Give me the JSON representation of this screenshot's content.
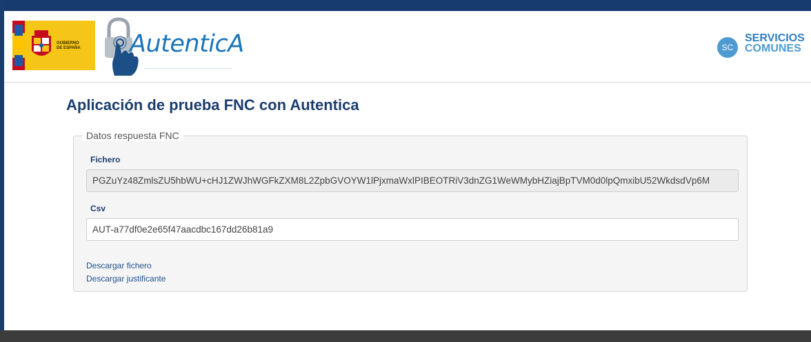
{
  "header": {
    "gobierno_text_line1": "GOBIERNO",
    "gobierno_text_line2": "DE ESPAÑA",
    "app_logo_text": "AutenticA",
    "servicios_line1": "SERVICIOS",
    "servicios_line2": "COMUNES",
    "servicios_badge": "SC"
  },
  "main": {
    "title": "Aplicación de prueba FNC con Autentica",
    "fieldset_legend": "Datos respuesta FNC",
    "fichero_label": "Fichero",
    "fichero_value": "PGZuYz48ZmlsZU5hbWU+cHJ1ZWJhWGFkZXM8L2ZpbGVOYW1lPjxmaWxlPIBEOTRiV3dnZG1WeWMybHZiajBpTVM0d0lpQmxibU52WkdsdVp6M",
    "csv_label": "Csv",
    "csv_value": "AUT-a77df0e2e65f47aacdbc167dd26b81a9",
    "link_download_file": "Descargar fichero",
    "link_download_receipt": "Descargar justificante"
  },
  "colors": {
    "top_bar": "#173b6c",
    "title": "#1b3d6d",
    "link": "#1e4f8c",
    "footer": "#3c3c3c"
  }
}
